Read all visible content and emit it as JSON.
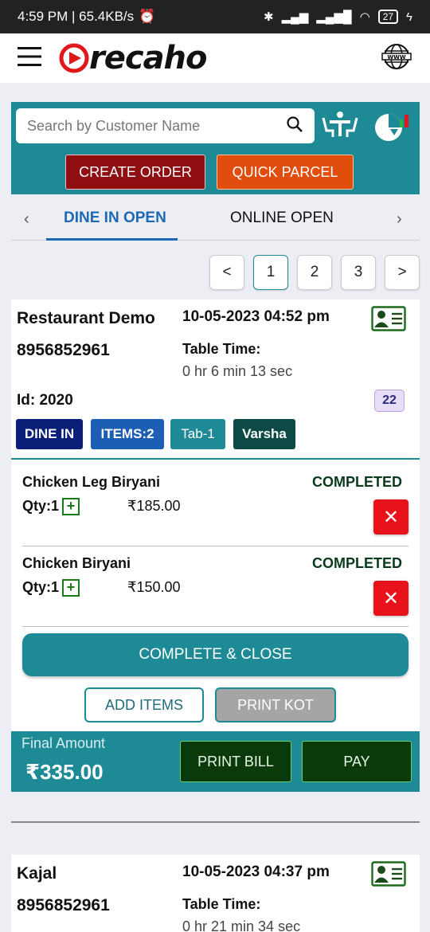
{
  "status_bar": {
    "time": "4:59 PM | 65.4KB/s",
    "battery": "27"
  },
  "header": {
    "brand": "recaho"
  },
  "search": {
    "placeholder": "Search by Customer Name"
  },
  "actions": {
    "create_order": "CREATE ORDER",
    "quick_parcel": "QUICK PARCEL"
  },
  "tabs": {
    "items": [
      "DINE IN OPEN",
      "ONLINE OPEN"
    ],
    "active": "DINE IN OPEN",
    "prev": "‹",
    "next": "›"
  },
  "pagination": {
    "prev": "<",
    "pages": [
      "1",
      "2",
      "3"
    ],
    "current": "1",
    "next": ">"
  },
  "orders": [
    {
      "customer": "Restaurant Demo",
      "datetime": "10-05-2023 04:52 pm",
      "phone": "8956852961",
      "table_time_label": "Table Time:",
      "table_time": "0 hr 6 min 13 sec",
      "id": "Id: 2020",
      "count": "22",
      "chips": {
        "type": "DINE IN",
        "items": "ITEMS:2",
        "table": "Tab-1",
        "waiter": "Varsha"
      },
      "chip_colors": {
        "type": "#0c1f78",
        "items": "#1d5eb5",
        "table": "#1d8a95",
        "waiter": "#0d4a45"
      },
      "line_items": [
        {
          "name": "Chicken Leg Biryani",
          "status": "COMPLETED",
          "qty": "Qty:1",
          "price": "₹185.00"
        },
        {
          "name": "Chicken Biryani",
          "status": "COMPLETED",
          "qty": "Qty:1",
          "price": "₹150.00"
        }
      ],
      "complete_close": "COMPLETE & CLOSE",
      "add_items": "ADD ITEMS",
      "print_kot": "PRINT KOT",
      "final_amount_label": "Final Amount",
      "final_amount": "₹335.00",
      "print_bill": "PRINT BILL",
      "pay": "PAY"
    },
    {
      "customer": "Kajal",
      "datetime": "10-05-2023 04:37 pm",
      "phone": "8956852961",
      "table_time_label": "Table Time:",
      "table_time": "0 hr 21 min 34 sec"
    }
  ],
  "colors": {
    "teal": "#1d8a95",
    "create": "#8e0e12",
    "quick": "#e04d0c",
    "delete": "#e8121a",
    "pay": "#0a3a0a",
    "active_tab": "#1d68b5"
  }
}
